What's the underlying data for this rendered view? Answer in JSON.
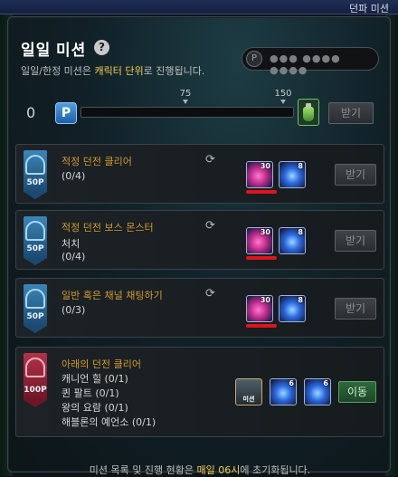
{
  "app_title": "던파 미션",
  "window": {
    "title": "일일 미션",
    "help_icon": "question-icon",
    "subtitle_pre": "일일/한정 미션은 ",
    "subtitle_hl": "캐릭터 단위",
    "subtitle_post": "로 진행됩니다.",
    "coupon_placeholder": "●●● ●●●● ●●●●"
  },
  "progress": {
    "points": "0",
    "marker_1": "75",
    "marker_2": "150",
    "fill_fraction": 0,
    "claim_label": "받기"
  },
  "missions": [
    {
      "points": "50P",
      "badge_color": "blue",
      "title": "적정 던전 클리어",
      "lines": [
        "(0/4)"
      ],
      "rewards": [
        {
          "type": "pink",
          "count": "30"
        },
        {
          "type": "blue",
          "count": "8"
        }
      ],
      "button": "받기",
      "button_active": false
    },
    {
      "points": "50P",
      "badge_color": "blue",
      "title": "적정 던전 보스 몬스터",
      "lines": [
        "처치",
        "(0/4)"
      ],
      "rewards": [
        {
          "type": "pink",
          "count": "30"
        },
        {
          "type": "blue",
          "count": "8"
        }
      ],
      "button": "받기",
      "button_active": false
    },
    {
      "points": "50P",
      "badge_color": "blue",
      "title": "일반 혹은 채널 채팅하기",
      "lines": [
        "(0/3)"
      ],
      "rewards": [
        {
          "type": "pink",
          "count": "30"
        },
        {
          "type": "blue",
          "count": "8"
        }
      ],
      "button": "받기",
      "button_active": false
    },
    {
      "points": "100P",
      "badge_color": "red",
      "title": "아래의 던전 클리어",
      "lines": [
        "캐니언 힐 (0/1)",
        "퀸 팔트 (0/1)",
        "왕의 요람 (0/1)",
        "해블론의 예언소 (0/1)"
      ],
      "rewards": [
        {
          "type": "mission-tag",
          "label": "미션"
        },
        {
          "type": "blue",
          "count": "6"
        },
        {
          "type": "blue",
          "count": "6"
        }
      ],
      "button": "이동",
      "button_active": true
    }
  ],
  "footer": {
    "pre": "미션 목록 및 진행 현황은 ",
    "hl": "매일 06시",
    "post": "에 초기화됩니다."
  },
  "colors": {
    "accent_gold": "#f2cf54",
    "mission_title": "#d39a2f",
    "badge_blue": "#1b4a70",
    "badge_red": "#6e1626",
    "annotation_red": "#e0141c"
  }
}
